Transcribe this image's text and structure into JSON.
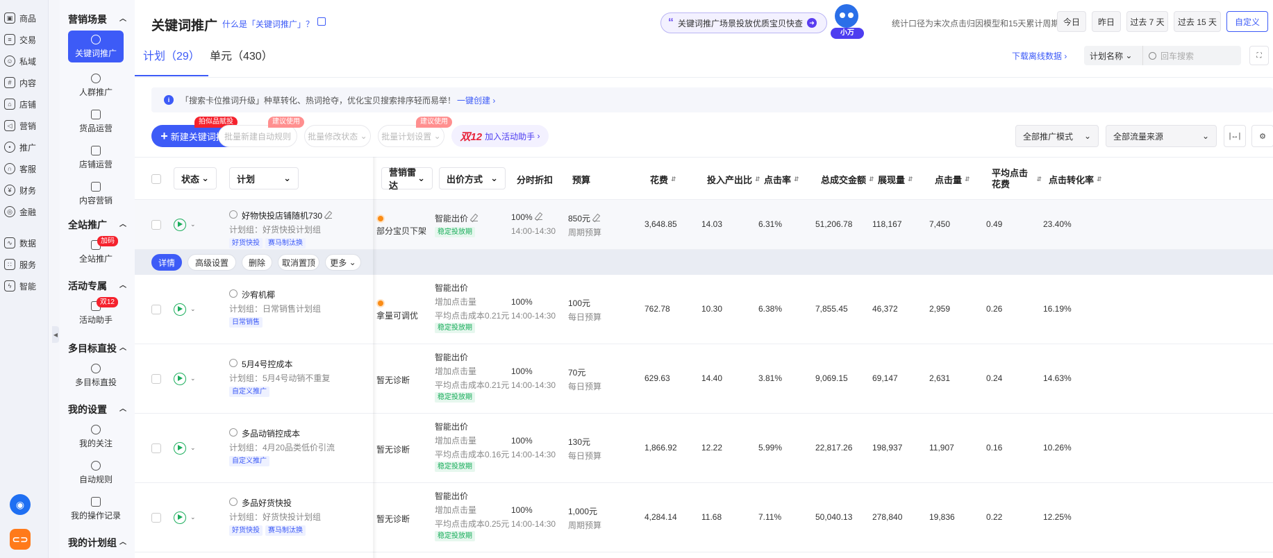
{
  "rail": {
    "items": [
      {
        "label": "商品",
        "icon": "box-icon"
      },
      {
        "label": "交易",
        "icon": "receipt-icon"
      },
      {
        "label": "私域",
        "icon": "user-group-icon"
      },
      {
        "label": "内容",
        "icon": "grid-icon"
      },
      {
        "label": "店铺",
        "icon": "shop-icon"
      },
      {
        "label": "营销",
        "icon": "megaphone-icon"
      },
      {
        "label": "推广",
        "icon": "location-icon"
      },
      {
        "label": "客服",
        "icon": "headset-icon"
      },
      {
        "label": "财务",
        "icon": "yen-icon"
      },
      {
        "label": "金融",
        "icon": "finance-icon"
      },
      {
        "label": "数据",
        "icon": "chart-icon"
      },
      {
        "label": "服务",
        "icon": "apps-icon"
      },
      {
        "label": "智能",
        "icon": "bolt-icon"
      }
    ]
  },
  "sidebar": {
    "groups": [
      {
        "label": "营销场景"
      },
      {
        "label": "全站推广"
      },
      {
        "label": "活动专属"
      },
      {
        "label": "多目标直投"
      },
      {
        "label": "我的设置"
      },
      {
        "label": "我的计划组"
      }
    ],
    "items": [
      {
        "label": "关键词推广",
        "active": true
      },
      {
        "label": "人群推广"
      },
      {
        "label": "货品运营"
      },
      {
        "label": "店铺运营"
      },
      {
        "label": "内容营销"
      },
      {
        "label": "全站推广",
        "badge": "加码"
      },
      {
        "label": "活动助手",
        "badge": "双12"
      },
      {
        "label": "多目标直投"
      },
      {
        "label": "我的关注"
      },
      {
        "label": "自动规则"
      },
      {
        "label": "我的操作记录"
      }
    ]
  },
  "header": {
    "title": "关键词推广",
    "help_link": "什么是「关键词推广」？",
    "promo_text": "关键词推广场景投放优质宝贝快查",
    "mascot_label": "小万",
    "stat_note": "统计口径为末次点击归因模型和15天累计周期",
    "dates": [
      "今日",
      "昨日",
      "过去 7 天",
      "过去 15 天",
      "自定义"
    ]
  },
  "tabs": [
    {
      "label": "计划（29）",
      "active": true
    },
    {
      "label": "单元（430）"
    }
  ],
  "download_link": "下载离线数据",
  "search": {
    "field": "计划名称",
    "placeholder": "回车搜索"
  },
  "notice": {
    "text": "「搜索卡位推词升级」种草转化、热词抢夺，优化宝贝搜索排序轻而易举！",
    "link": "一键创建"
  },
  "toolbar": {
    "new_button": "新建关键词推广",
    "new_badge": "拍似品赋投",
    "batch_rule": "批量新建自动规则",
    "batch_rule_badge": "建议使用",
    "batch_status": "批量修改状态",
    "batch_setting": "批量计划设置",
    "batch_setting_badge": "建议使用",
    "activity_prefix": "双12",
    "activity_label": "加入活动助手",
    "mode_select": "全部推广模式",
    "source_select": "全部流量来源"
  },
  "table": {
    "headers": {
      "status": "状态",
      "plan": "计划",
      "radar": "营销雷达",
      "bid": "出价方式",
      "discount": "分时折扣",
      "budget": "预算",
      "cost": "花费",
      "roi": "投入产出比",
      "ctr": "点击率",
      "gmv": "总成交金额",
      "impressions": "展现量",
      "clicks": "点击量",
      "cpc": "平均点击花费",
      "cvr": "点击转化率"
    },
    "rows": [
      {
        "name": "好物快投店铺随机730",
        "group": "计划组：好货快投计划组",
        "tags": [
          "好货快投",
          "赛马制汰换"
        ],
        "radar": "部分宝贝下架",
        "radar_dot": true,
        "bid": "智能出价",
        "bid_goal": "",
        "bid_cost": "",
        "bid_tag": "稳定投放期",
        "discount": "100%",
        "time": "14:00-14:30",
        "budget": "850元",
        "budget_type": "周期预算",
        "cost": "3,648.85",
        "roi": "14.03",
        "ctr": "6.31%",
        "gmv": "51,206.78",
        "impressions": "118,167",
        "clicks": "7,450",
        "cpc": "0.49",
        "cvr": "23.40%"
      },
      {
        "name": "沙宥机椰",
        "group": "计划组：日常销售计划组",
        "tags": [
          "日常销售"
        ],
        "radar": "拿量可调优",
        "radar_dot": true,
        "bid": "智能出价",
        "bid_goal": "增加点击量",
        "bid_cost": "平均点击成本0.21元",
        "bid_tag": "稳定投放期",
        "discount": "100%",
        "time": "14:00-14:30",
        "budget": "100元",
        "budget_type": "每日预算",
        "cost": "762.78",
        "roi": "10.30",
        "ctr": "6.38%",
        "gmv": "7,855.45",
        "impressions": "46,372",
        "clicks": "2,959",
        "cpc": "0.26",
        "cvr": "16.19%"
      },
      {
        "name": "5月4号控成本",
        "group": "计划组：5月4号动销不重复",
        "tags": [
          "自定义推广"
        ],
        "radar": "暂无诊断",
        "radar_dot": false,
        "bid": "智能出价",
        "bid_goal": "增加点击量",
        "bid_cost": "平均点击成本0.21元",
        "bid_tag": "稳定投放期",
        "discount": "100%",
        "time": "14:00-14:30",
        "budget": "70元",
        "budget_type": "每日预算",
        "cost": "629.63",
        "roi": "14.40",
        "ctr": "3.81%",
        "gmv": "9,069.15",
        "impressions": "69,147",
        "clicks": "2,631",
        "cpc": "0.24",
        "cvr": "14.63%"
      },
      {
        "name": "多品动销控成本",
        "group": "计划组：4月20品类低价引流",
        "tags": [
          "自定义推广"
        ],
        "radar": "暂无诊断",
        "radar_dot": false,
        "bid": "智能出价",
        "bid_goal": "增加点击量",
        "bid_cost": "平均点击成本0.16元",
        "bid_tag": "稳定投放期",
        "discount": "100%",
        "time": "14:00-14:30",
        "budget": "130元",
        "budget_type": "每日预算",
        "cost": "1,866.92",
        "roi": "12.22",
        "ctr": "5.99%",
        "gmv": "22,817.26",
        "impressions": "198,937",
        "clicks": "11,907",
        "cpc": "0.16",
        "cvr": "10.26%"
      },
      {
        "name": "多品好货快投",
        "group": "计划组：好货快投计划组",
        "tags": [
          "好货快投",
          "赛马制汰换"
        ],
        "radar": "暂无诊断",
        "radar_dot": false,
        "bid": "智能出价",
        "bid_goal": "增加点击量",
        "bid_cost": "平均点击成本0.25元",
        "bid_tag": "稳定投放期",
        "discount": "100%",
        "time": "14:00-14:30",
        "budget": "1,000元",
        "budget_type": "周期预算",
        "cost": "4,284.14",
        "roi": "11.68",
        "ctr": "7.11%",
        "gmv": "50,040.13",
        "impressions": "278,840",
        "clicks": "19,836",
        "cpc": "0.22",
        "cvr": "12.25%"
      }
    ]
  },
  "row_actions": [
    "详情",
    "高级设置",
    "删除",
    "取消置顶",
    "更多"
  ],
  "colors": {
    "primary": "#3d5bf7",
    "success": "#1aad5b",
    "danger": "#f5222d",
    "warning": "#fa8c16"
  }
}
